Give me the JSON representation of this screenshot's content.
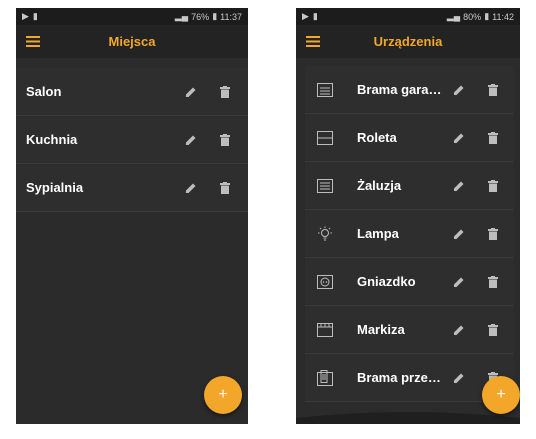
{
  "left_screen": {
    "status": {
      "left_icons": [
        "play-icon",
        "notification-icon"
      ],
      "right_text": "76%",
      "time": "11:37"
    },
    "title": "Miejsca",
    "items": [
      {
        "label": "Salon"
      },
      {
        "label": "Kuchnia"
      },
      {
        "label": "Sypialnia"
      }
    ],
    "fab_symbol": "+"
  },
  "right_screen": {
    "status": {
      "left_icons": [
        "play-icon",
        "notification-icon"
      ],
      "right_text": "80%",
      "time": "11:42"
    },
    "title": "Urządzenia",
    "items": [
      {
        "label": "Brama garaż…",
        "icon": "garage-gate-icon"
      },
      {
        "label": "Roleta",
        "icon": "roller-blind-icon"
      },
      {
        "label": "Żaluzja",
        "icon": "venetian-blind-icon"
      },
      {
        "label": "Lampa",
        "icon": "lamp-icon"
      },
      {
        "label": "Gniazdko",
        "icon": "socket-icon"
      },
      {
        "label": "Markiza",
        "icon": "awning-icon"
      },
      {
        "label": "Brama przes…",
        "icon": "sliding-gate-icon"
      }
    ],
    "fab_symbol": "+"
  },
  "colors": {
    "accent": "#f2a72a",
    "background": "#2b2b2b",
    "text": "#ffffff"
  }
}
